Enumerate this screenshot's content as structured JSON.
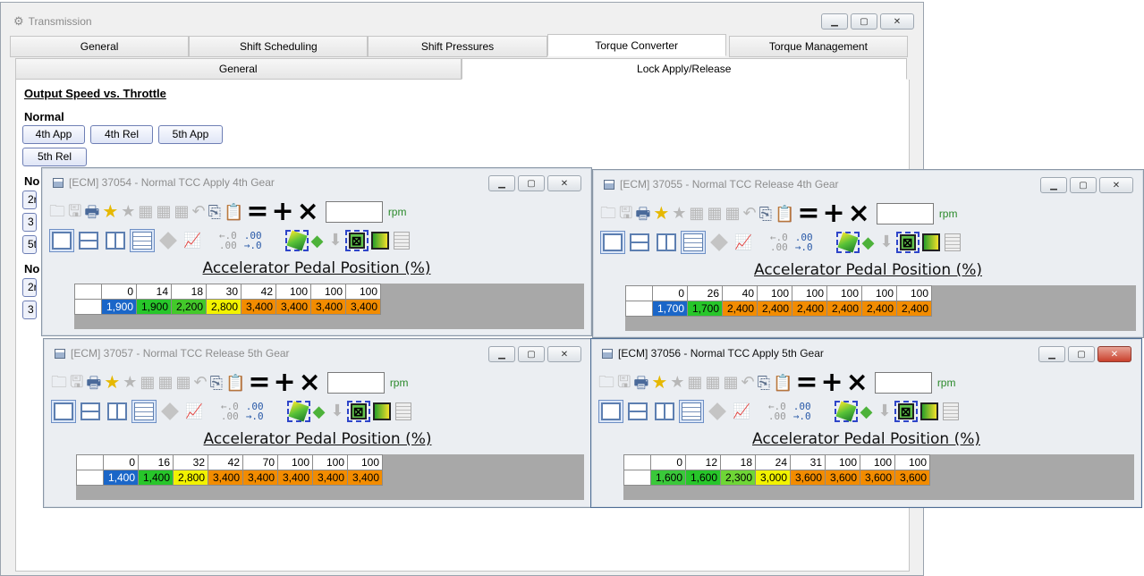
{
  "main": {
    "title": "Transmission",
    "tabs": [
      "General",
      "Shift Scheduling",
      "Shift Pressures",
      "Torque Converter",
      "Torque Management"
    ],
    "subtabs": [
      "General",
      "Lock Apply/Release"
    ],
    "section_title": "Output Speed vs. Throttle",
    "normal_label": "Normal",
    "buttons": [
      "4th App",
      "4th Rel",
      "5th App",
      "5th Rel"
    ],
    "stub_labels": [
      "No",
      "No"
    ],
    "stub_buttons": [
      "2r",
      "3",
      "5t",
      "2r",
      "3"
    ]
  },
  "toolbar": {
    "eq": "=",
    "plus": "+",
    "times": "×",
    "rpm": "rpm",
    "dec1a": "←.0",
    "dec1b": ".00",
    "dec2a": ".00",
    "dec2b": "→.0"
  },
  "icons": [
    "folder-icon",
    "save-icon",
    "print-icon",
    "favorite-add-icon",
    "favorite-icon",
    "table-icon",
    "table-icon",
    "table-icon",
    "undo-icon",
    "copy-icon",
    "paste-icon"
  ],
  "windows": [
    {
      "title": "[ECM] 37054 - Normal TCC Apply 4th Gear",
      "axis": "Accelerator Pedal Position (%)",
      "x": [
        "0",
        "14",
        "18",
        "30",
        "42",
        "100",
        "100",
        "100"
      ],
      "y": [
        "1,900",
        "1,900",
        "2,200",
        "2,800",
        "3,400",
        "3,400",
        "3,400",
        "3,400"
      ],
      "colors": [
        "#1a66c8",
        "#27c62a",
        "#43c92a",
        "#f2f200",
        "#f28c00",
        "#f28c00",
        "#f28c00",
        "#f28c00"
      ]
    },
    {
      "title": "[ECM] 37055 - Normal TCC Release 4th Gear",
      "axis": "Accelerator Pedal Position (%)",
      "x": [
        "0",
        "26",
        "40",
        "100",
        "100",
        "100",
        "100",
        "100"
      ],
      "y": [
        "1,700",
        "1,700",
        "2,400",
        "2,400",
        "2,400",
        "2,400",
        "2,400",
        "2,400"
      ],
      "colors": [
        "#1a66c8",
        "#27c62a",
        "#f28c00",
        "#f28c00",
        "#f28c00",
        "#f28c00",
        "#f28c00",
        "#f28c00"
      ]
    },
    {
      "title": "[ECM] 37057 - Normal TCC Release 5th Gear",
      "axis": "Accelerator Pedal Position (%)",
      "x": [
        "0",
        "16",
        "32",
        "42",
        "70",
        "100",
        "100",
        "100"
      ],
      "y": [
        "1,400",
        "1,400",
        "2,800",
        "3,400",
        "3,400",
        "3,400",
        "3,400",
        "3,400"
      ],
      "colors": [
        "#1a66c8",
        "#27c62a",
        "#f2f200",
        "#f28c00",
        "#f28c00",
        "#f28c00",
        "#f28c00",
        "#f28c00"
      ]
    },
    {
      "title": "[ECM] 37056 - Normal TCC Apply 5th Gear",
      "axis": "Accelerator Pedal Position (%)",
      "x": [
        "0",
        "12",
        "18",
        "24",
        "31",
        "100",
        "100",
        "100"
      ],
      "y": [
        "1,600",
        "1,600",
        "2,300",
        "3,000",
        "3,600",
        "3,600",
        "3,600",
        "3,600"
      ],
      "colors": [
        "#3ac83a",
        "#27c62a",
        "#6fd636",
        "#f2f200",
        "#f28c00",
        "#f28c00",
        "#f28c00",
        "#f28c00"
      ]
    }
  ]
}
